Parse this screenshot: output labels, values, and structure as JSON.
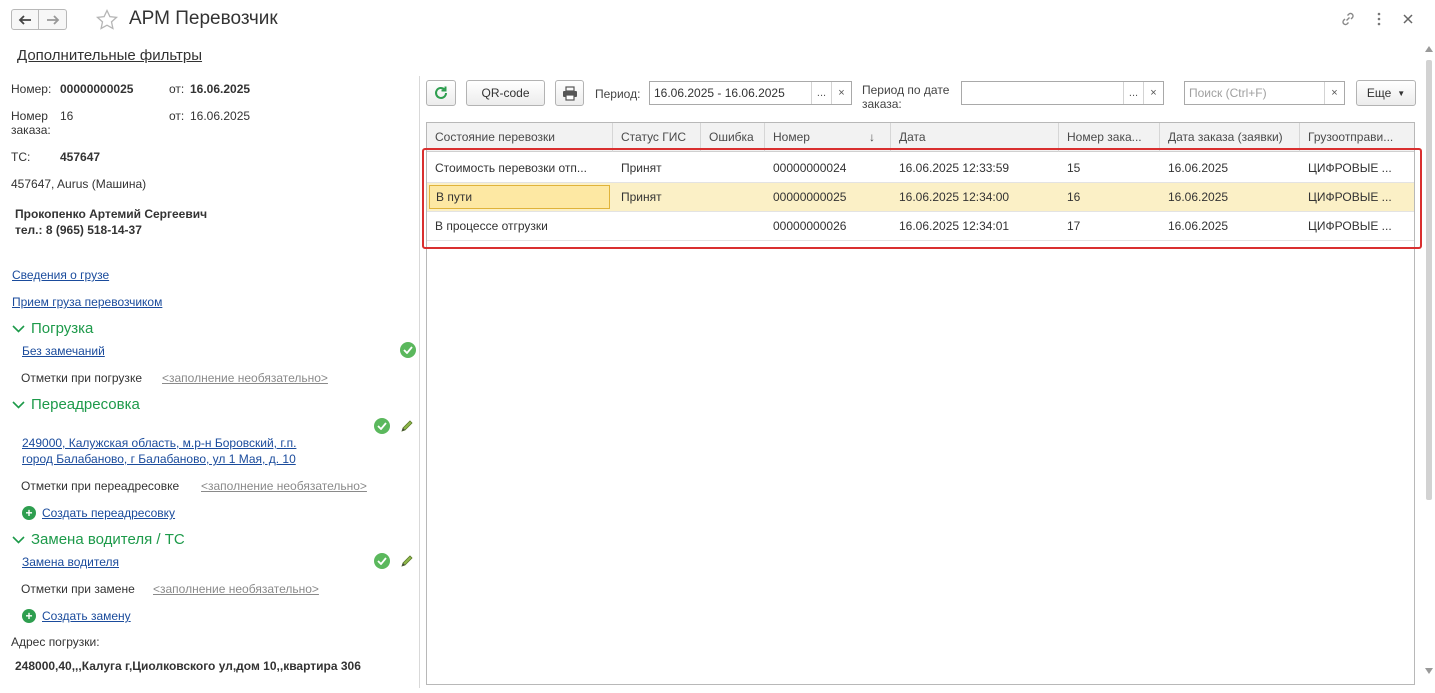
{
  "window": {
    "title": "АРМ Перевозчик"
  },
  "filters_link": "Дополнительные фильтры",
  "details": {
    "number_label": "Номер:",
    "number_value": "00000000025",
    "from_label": "от:",
    "date_value": "16.06.2025",
    "order_label": "Номер заказа:",
    "order_value": "16",
    "order_from_label": "от:",
    "order_date": "16.06.2025",
    "vehicle_label": "ТС:",
    "vehicle_value": "457647",
    "vehicle_desc": "457647, Aurus (Машина)",
    "driver_name": "Прокопенко Артемий Сергеевич",
    "driver_phone": "тел.: 8 (965) 518-14-37"
  },
  "links": {
    "cargo_info": "Сведения о грузе",
    "cargo_accept": "Прием груза перевозчиком"
  },
  "loading": {
    "header": "Погрузка",
    "status_link": "Без замечаний",
    "notes_label": "Отметки при погрузке",
    "notes_placeholder": "<заполнение необязательно>"
  },
  "readdress": {
    "header": "Переадресовка",
    "address_line1": "249000, Калужская область, м.р-н Боровский, г.п.",
    "address_line2": "город Балабаново, г Балабаново, ул 1 Мая, д. 10",
    "notes_label": "Отметки при переадресовке",
    "notes_placeholder": "<заполнение необязательно>",
    "create_link": "Создать переадресовку"
  },
  "driver_change": {
    "header": "Замена водителя / ТС",
    "status_link": "Замена водителя",
    "notes_label": "Отметки при замене",
    "notes_placeholder": "<заполнение необязательно>",
    "create_link": "Создать замену"
  },
  "loading_address": {
    "label": "Адрес погрузки:",
    "value": "248000,40,,,Калуга г,Циолковского ул,дом 10,,квартира 306"
  },
  "toolbar": {
    "qr_label": "QR-code",
    "period_label": "Период:",
    "period_value": "16.06.2025 - 16.06.2025",
    "period_order_label_1": "Период по дате",
    "period_order_label_2": "заказа:",
    "period_order_value": "",
    "search_placeholder": "Поиск (Ctrl+F)",
    "more_label": "Еще",
    "ellipsis": "...",
    "clear": "×"
  },
  "table": {
    "columns": [
      "Состояние перевозки",
      "Статус ГИС",
      "Ошибка",
      "Номер",
      "Дата",
      "Номер зака...",
      "Дата заказа (заявки)",
      "Грузоотправи..."
    ],
    "sort_indicator": "↓",
    "rows": [
      {
        "state": "Стоимость перевозки отп...",
        "gis": "Принят",
        "error": "",
        "number": "00000000024",
        "date": "16.06.2025 12:33:59",
        "order_no": "15",
        "order_date": "16.06.2025",
        "shipper": "ЦИФРОВЫЕ ..."
      },
      {
        "state": "В пути",
        "gis": "Принят",
        "error": "",
        "number": "00000000025",
        "date": "16.06.2025 12:34:00",
        "order_no": "16",
        "order_date": "16.06.2025",
        "shipper": "ЦИФРОВЫЕ ..."
      },
      {
        "state": "В процессе отгрузки",
        "gis": "",
        "error": "",
        "number": "00000000026",
        "date": "16.06.2025 12:34:01",
        "order_no": "17",
        "order_date": "16.06.2025",
        "shipper": "ЦИФРОВЫЕ ..."
      }
    ],
    "selected_row": 1
  }
}
